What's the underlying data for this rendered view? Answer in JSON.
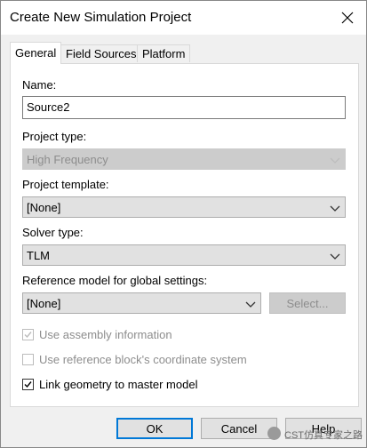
{
  "window": {
    "title": "Create New Simulation Project"
  },
  "tabs": [
    {
      "label": "General"
    },
    {
      "label": "Field Sources"
    },
    {
      "label": "Platform"
    }
  ],
  "general": {
    "name_label": "Name:",
    "name_value": "Source2",
    "project_type_label": "Project type:",
    "project_type_value": "High Frequency",
    "project_template_label": "Project template:",
    "project_template_value": "[None]",
    "solver_type_label": "Solver type:",
    "solver_type_value": "TLM",
    "reference_model_label": "Reference model for global settings:",
    "reference_model_value": "[None]",
    "select_button": "Select...",
    "checkboxes": [
      {
        "label": "Use assembly information",
        "checked": true,
        "enabled": false
      },
      {
        "label": "Use reference block's coordinate system",
        "checked": false,
        "enabled": false
      },
      {
        "label": "Link geometry to master model",
        "checked": true,
        "enabled": true
      }
    ]
  },
  "footer": {
    "ok": "OK",
    "cancel": "Cancel",
    "help": "Help"
  },
  "watermark": {
    "text": "CST仿真专家之路"
  },
  "colors": {
    "accent": "#0078d7",
    "disabled_text": "#8d8d8d",
    "panel_bg": "#ffffff",
    "dialog_bg": "#f0f0f0"
  }
}
